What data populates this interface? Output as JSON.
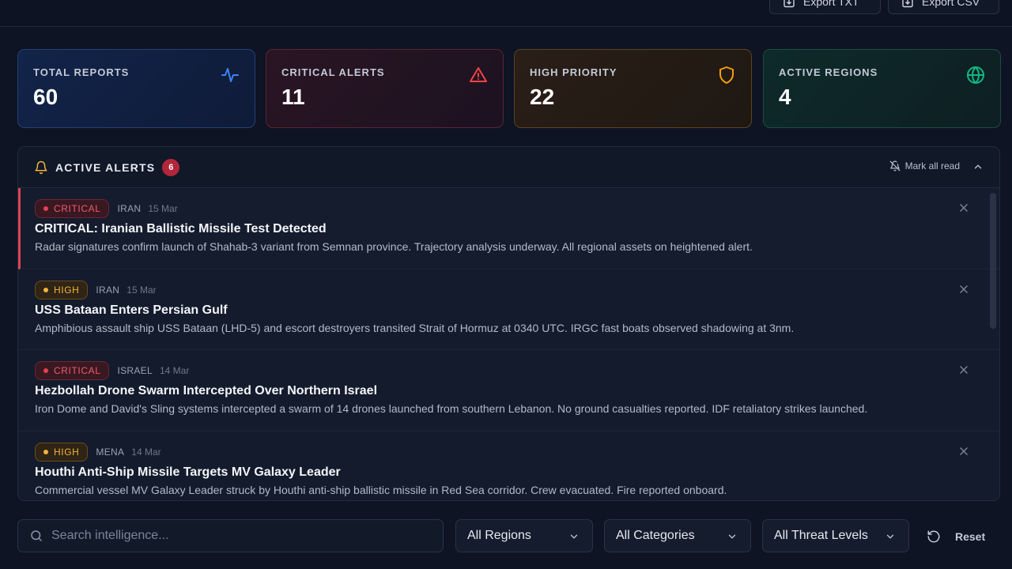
{
  "header": {
    "export_txt": "Export TXT",
    "export_csv": "Export CSV"
  },
  "stats": [
    {
      "label": "TOTAL REPORTS",
      "value": "60",
      "icon": "activity-icon",
      "color": "#3b82f6"
    },
    {
      "label": "CRITICAL ALERTS",
      "value": "11",
      "icon": "warning-icon",
      "color": "#ef4444"
    },
    {
      "label": "HIGH PRIORITY",
      "value": "22",
      "icon": "shield-icon",
      "color": "#f59e0b"
    },
    {
      "label": "ACTIVE REGIONS",
      "value": "4",
      "icon": "globe-icon",
      "color": "#10b981"
    }
  ],
  "alerts_panel": {
    "title": "ACTIVE ALERTS",
    "count": "6",
    "mark_all_read": "Mark all read",
    "items": [
      {
        "level": "CRITICAL",
        "region": "IRAN",
        "date": "15 Mar",
        "title": "CRITICAL: Iranian Ballistic Missile Test Detected",
        "description": "Radar signatures confirm launch of Shahab-3 variant from Semnan province. Trajectory analysis underway. All regional assets on heightened alert."
      },
      {
        "level": "HIGH",
        "region": "IRAN",
        "date": "15 Mar",
        "title": "USS Bataan Enters Persian Gulf",
        "description": "Amphibious assault ship USS Bataan (LHD-5) and escort destroyers transited Strait of Hormuz at 0340 UTC. IRGC fast boats observed shadowing at 3nm."
      },
      {
        "level": "CRITICAL",
        "region": "ISRAEL",
        "date": "14 Mar",
        "title": "Hezbollah Drone Swarm Intercepted Over Northern Israel",
        "description": "Iron Dome and David's Sling systems intercepted a swarm of 14 drones launched from southern Lebanon. No ground casualties reported. IDF retaliatory strikes launched."
      },
      {
        "level": "HIGH",
        "region": "MENA",
        "date": "14 Mar",
        "title": "Houthi Anti-Ship Missile Targets MV Galaxy Leader",
        "description": "Commercial vessel MV Galaxy Leader struck by Houthi anti-ship ballistic missile in Red Sea corridor. Crew evacuated. Fire reported onboard."
      }
    ]
  },
  "filters": {
    "search_placeholder": "Search intelligence...",
    "region": "All Regions",
    "category": "All Categories",
    "threat_level": "All Threat Levels",
    "reset": "Reset"
  }
}
